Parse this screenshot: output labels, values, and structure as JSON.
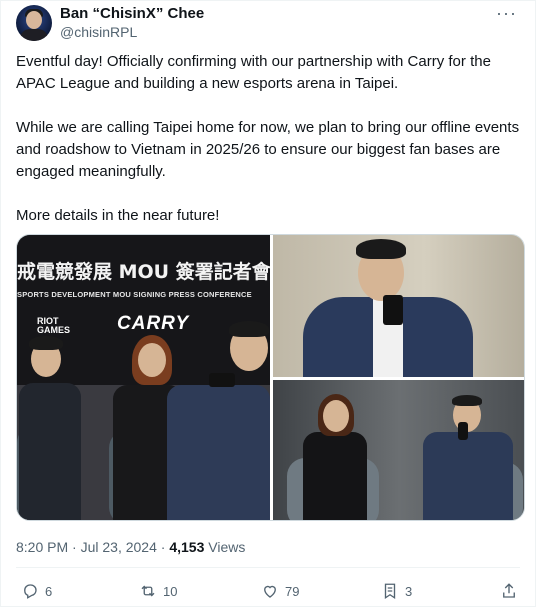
{
  "author": {
    "display_name": "Ban “ChisinX” Chee",
    "handle": "@chisinRPL"
  },
  "more_label": "···",
  "tweet": {
    "paragraphs": [
      "Eventful day! Officially confirming with our partnership with Carry for the APAC League and building a new esports arena in Taipei.",
      "While we are calling Taipei home for now, we plan to bring our offline events and roadshow to Vietnam in 2025/26 to ensure our biggest fan bases are engaged meaningfully.",
      "More details in the near future!"
    ]
  },
  "media": {
    "banner_zh": "戒電競發展 MOU 簽署記者會",
    "banner_en": "SPORTS DEVELOPMENT MOU SIGNING PRESS CONFERENCE",
    "logo_riot_1": "RIOT",
    "logo_riot_2": "GAMES",
    "logo_carry": "CARRY"
  },
  "meta": {
    "time": "8:20 PM",
    "separator": "·",
    "date": "Jul 23, 2024",
    "views_count": "4,153",
    "views_label": "Views"
  },
  "actions": {
    "replies": "6",
    "reposts": "10",
    "likes": "79",
    "bookmarks": "3"
  },
  "icons": [
    "reply-icon",
    "repost-icon",
    "like-icon",
    "bookmark-icon",
    "share-icon"
  ],
  "colors": {
    "text": "#0f1419",
    "secondary": "#536471",
    "border": "#eff3f4"
  }
}
